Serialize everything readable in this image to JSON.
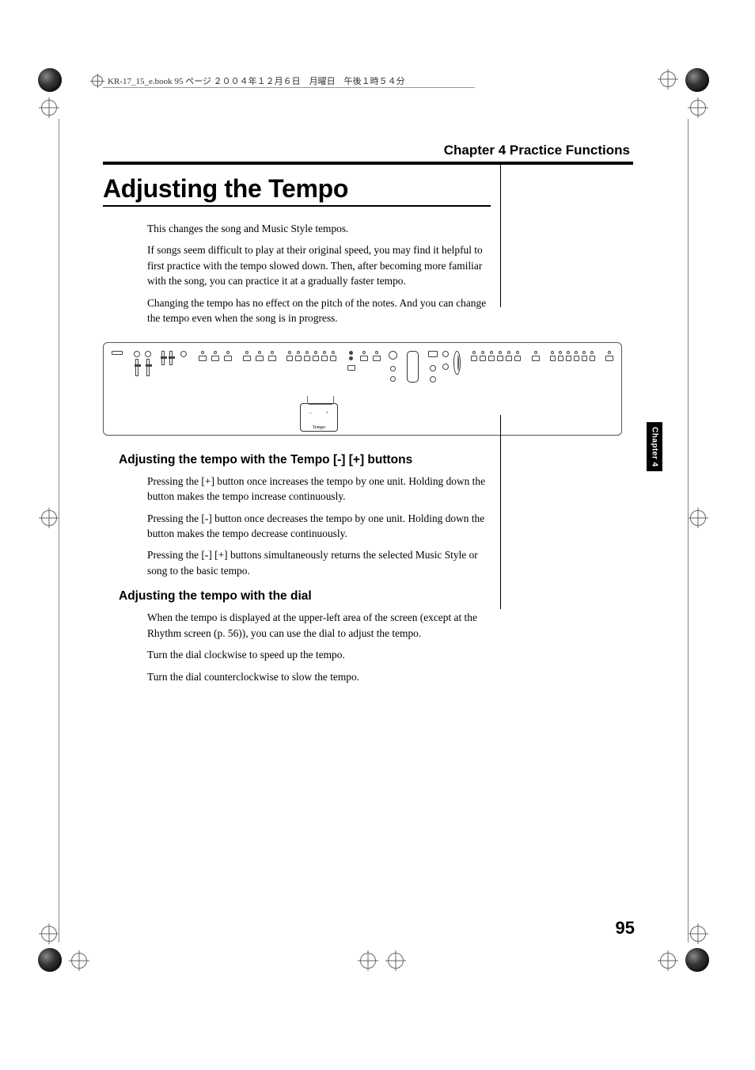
{
  "header": {
    "running_head": "KR-17_15_e.book 95 ページ ２００４年１２月６日　月曜日　午後１時５４分"
  },
  "chapter_header": "Chapter 4 Practice Functions",
  "title": "Adjusting the Tempo",
  "intro": {
    "p1": "This changes the song and Music Style tempos.",
    "p2": "If songs seem difficult to play at their original speed, you may find it helpful to first practice with the tempo slowed down. Then, after becoming more familiar with the song, you can practice it at a gradually faster tempo.",
    "p3": "Changing the tempo has no effect on the pitch of the notes. And you can change the tempo even when the song is in progress."
  },
  "diagram": {
    "callout_label": "Tempo",
    "callout_minus": "–",
    "callout_plus": "+"
  },
  "section1": {
    "heading": "Adjusting the tempo with the Tempo [-] [+] buttons",
    "p1": "Pressing the [+] button once increases the tempo by one unit. Holding down the button makes the tempo increase continuously.",
    "p2": "Pressing the [-] button once decreases the tempo by one unit. Holding down the button makes the tempo decrease continuously.",
    "p3": "Pressing the [-] [+] buttons simultaneously returns the selected Music Style or song to the basic tempo."
  },
  "section2": {
    "heading": "Adjusting the tempo with the dial",
    "p1": "When the tempo is displayed at the upper-left area of the screen (except at the Rhythm screen (p. 56)), you can use the dial to adjust the tempo.",
    "p2": "Turn the dial clockwise to speed up the tempo.",
    "p3": "Turn the dial counterclockwise to slow the tempo."
  },
  "side_tab": "Chapter 4",
  "page_number": "95"
}
